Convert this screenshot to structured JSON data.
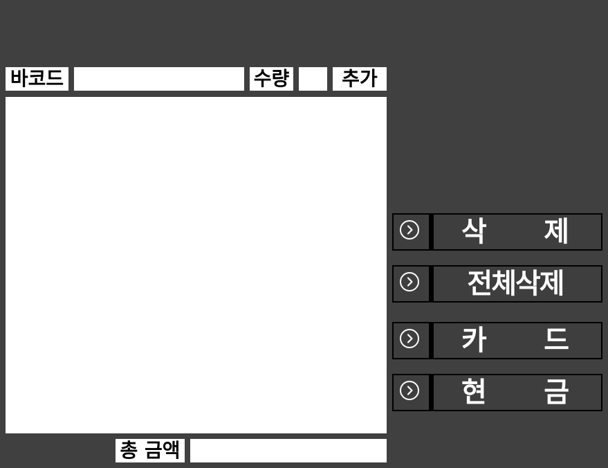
{
  "form": {
    "barcode_label": "바코드",
    "barcode_value": "",
    "qty_label": "수량",
    "qty_value": "",
    "add_label": "추가"
  },
  "total": {
    "label": "총 금액",
    "value": ""
  },
  "actions": {
    "delete": [
      "삭",
      "제"
    ],
    "delete_all": "전체삭제",
    "card": [
      "카",
      "드"
    ],
    "cash": [
      "현",
      "금"
    ]
  },
  "icons": {
    "action_icon": "chevron-right-circle-icon"
  },
  "colors": {
    "background": "#404040",
    "panel": "#ffffff",
    "button_text": "#ffffff"
  }
}
